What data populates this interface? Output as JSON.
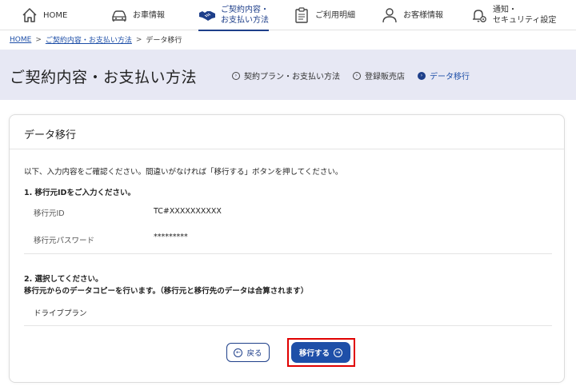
{
  "nav": {
    "items": [
      {
        "label": "HOME",
        "icon": "home-icon"
      },
      {
        "label": "お車情報",
        "icon": "car-icon"
      },
      {
        "label": "ご契約内容・\nお支払い方法",
        "icon": "handshake-icon"
      },
      {
        "label": "ご利用明細",
        "icon": "clipboard-icon"
      },
      {
        "label": "お客様情報",
        "icon": "person-icon"
      },
      {
        "label": "通知・\nセキュリティ設定",
        "icon": "bell-gear-icon"
      }
    ]
  },
  "breadcrumb": {
    "home": "HOME",
    "parent": "ご契約内容・お支払い方法",
    "current": "データ移行",
    "sep": ">"
  },
  "band": {
    "title": "ご契約内容・お支払い方法",
    "steps": [
      {
        "label": "契約プラン・お支払い方法",
        "current": false
      },
      {
        "label": "登録販売店",
        "current": false
      },
      {
        "label": "データ移行",
        "current": true
      }
    ]
  },
  "card": {
    "title": "データ移行",
    "intro": "以下、入力内容をご確認ください。間違いがなければ「移行する」ボタンを押してください。",
    "section1": {
      "title": "1. 移行元IDをご入力ください。",
      "id_label": "移行元ID",
      "id_value": "TC#XXXXXXXXXX",
      "pw_label": "移行元パスワード",
      "pw_value": "*********"
    },
    "section2": {
      "title": "2. 選択してください。",
      "desc": "移行元からのデータコピーを行います。（移行元と移行先のデータは合算されます）",
      "plan": "ドライブプラン"
    },
    "back_label": "戻る",
    "next_label": "移行する"
  },
  "colors": {
    "brand": "#1e3f8a",
    "band_bg": "#e7e8f4",
    "highlight": "#e00000"
  }
}
